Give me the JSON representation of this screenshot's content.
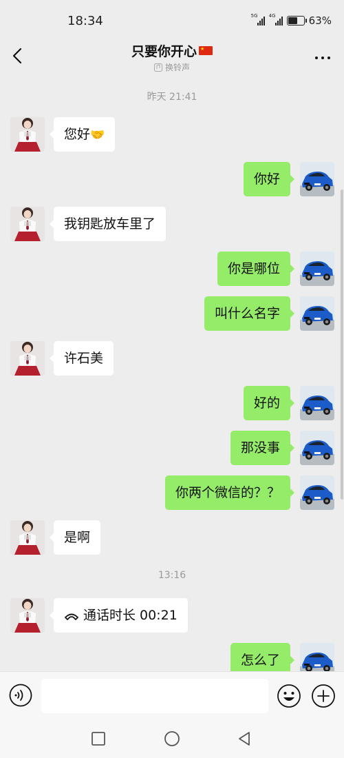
{
  "status": {
    "time": "18:34",
    "network1": "5G",
    "network2": "4G",
    "battery_text": "63%",
    "battery_level": 0.63
  },
  "header": {
    "title": "只要你开心",
    "subtitle": "换铃声"
  },
  "messages": {
    "ts1": "昨天 21:41",
    "m1": "您好",
    "m2": "你好",
    "m3": "我钥匙放车里了",
    "m4": "你是哪位",
    "m5": "叫什么名字",
    "m6": "许石美",
    "m7": "好的",
    "m8": "那没事",
    "m9": "你两个微信的？？",
    "m10": "是啊",
    "ts2": "13:16",
    "m11": "通话时长 00:21",
    "m12": "怎么了"
  },
  "input": {
    "placeholder": "",
    "value": ""
  },
  "colors": {
    "background": "#ededed",
    "bubble_self": "#95ec69",
    "bubble_other": "#ffffff"
  },
  "icons": [
    "back-arrow-icon",
    "more-dots-icon",
    "voice-icon",
    "emoji-icon",
    "plus-icon",
    "phone-icon",
    "nav-recent-icon",
    "nav-home-icon",
    "nav-back-icon"
  ]
}
